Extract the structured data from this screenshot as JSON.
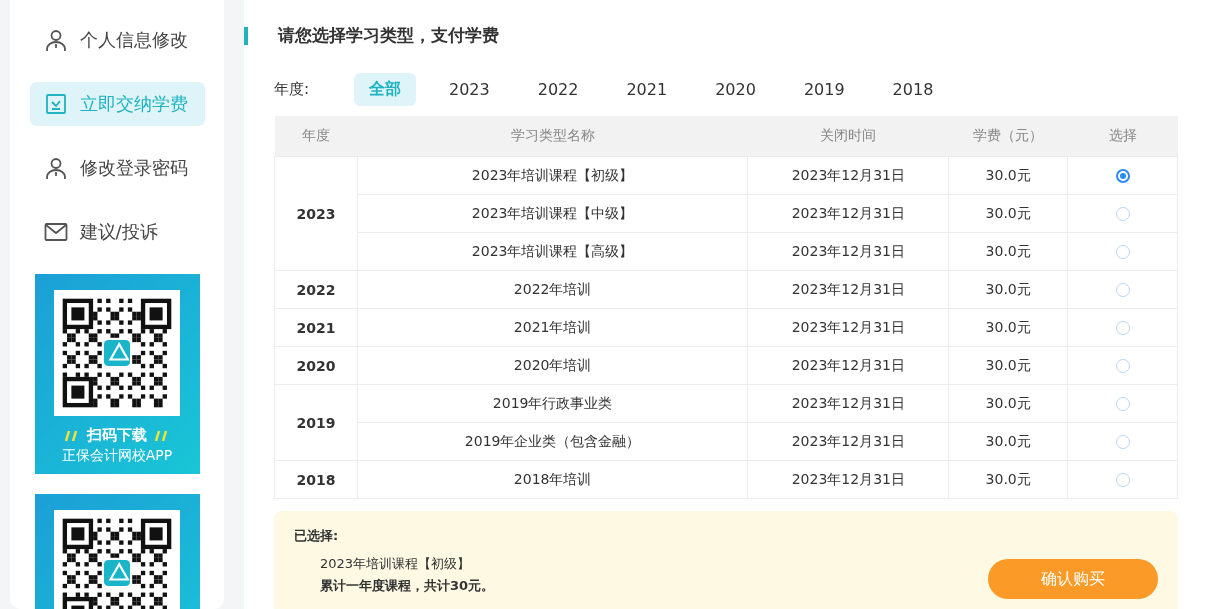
{
  "sidebar": {
    "items": [
      {
        "label": "个人信息修改",
        "kind": "person",
        "selected": false
      },
      {
        "label": "立即交纳学费",
        "kind": "checklist",
        "selected": true
      },
      {
        "label": "修改登录密码",
        "kind": "person",
        "selected": false
      },
      {
        "label": "建议/投诉",
        "kind": "mail",
        "selected": false
      }
    ],
    "banners": [
      {
        "kind": "qr-banner",
        "title": "扫码下载",
        "subtitle": "正保会计网校APP"
      },
      {
        "kind": "qr-banner"
      }
    ]
  },
  "main": {
    "title": "请您选择学习类型，支付学费",
    "filter": {
      "label": "年度:",
      "options": [
        {
          "label": "全部",
          "selected": true
        },
        {
          "label": "2023",
          "selected": false
        },
        {
          "label": "2022",
          "selected": false
        },
        {
          "label": "2021",
          "selected": false
        },
        {
          "label": "2020",
          "selected": false
        },
        {
          "label": "2019",
          "selected": false
        },
        {
          "label": "2018",
          "selected": false
        }
      ]
    },
    "table": {
      "columns": [
        "年度",
        "学习类型名称",
        "关闭时间",
        "学费（元）",
        "选择"
      ],
      "groups": [
        {
          "year": "2023",
          "rows": [
            {
              "name": "2023年培训课程【初级】",
              "close": "2023年12月31日",
              "fee": "30.0元",
              "selected": true
            },
            {
              "name": "2023年培训课程【中级】",
              "close": "2023年12月31日",
              "fee": "30.0元",
              "selected": false
            },
            {
              "name": "2023年培训课程【高级】",
              "close": "2023年12月31日",
              "fee": "30.0元",
              "selected": false
            }
          ]
        },
        {
          "year": "2022",
          "rows": [
            {
              "name": "2022年培训",
              "close": "2023年12月31日",
              "fee": "30.0元",
              "selected": false
            }
          ]
        },
        {
          "year": "2021",
          "rows": [
            {
              "name": "2021年培训",
              "close": "2023年12月31日",
              "fee": "30.0元",
              "selected": false
            }
          ]
        },
        {
          "year": "2020",
          "rows": [
            {
              "name": "2020年培训",
              "close": "2023年12月31日",
              "fee": "30.0元",
              "selected": false
            }
          ]
        },
        {
          "year": "2019",
          "rows": [
            {
              "name": "2019年行政事业类",
              "close": "2023年12月31日",
              "fee": "30.0元",
              "selected": false
            },
            {
              "name": "2019年企业类（包含金融）",
              "close": "2023年12月31日",
              "fee": "30.0元",
              "selected": false
            }
          ]
        },
        {
          "year": "2018",
          "rows": [
            {
              "name": "2018年培训",
              "close": "2023年12月31日",
              "fee": "30.0元",
              "selected": false
            }
          ]
        }
      ]
    },
    "summary": {
      "label": "已选择:",
      "item": "2023年培训课程【初级】",
      "total": "累计一年度课程，共计30元。",
      "button": "确认购买"
    }
  }
}
